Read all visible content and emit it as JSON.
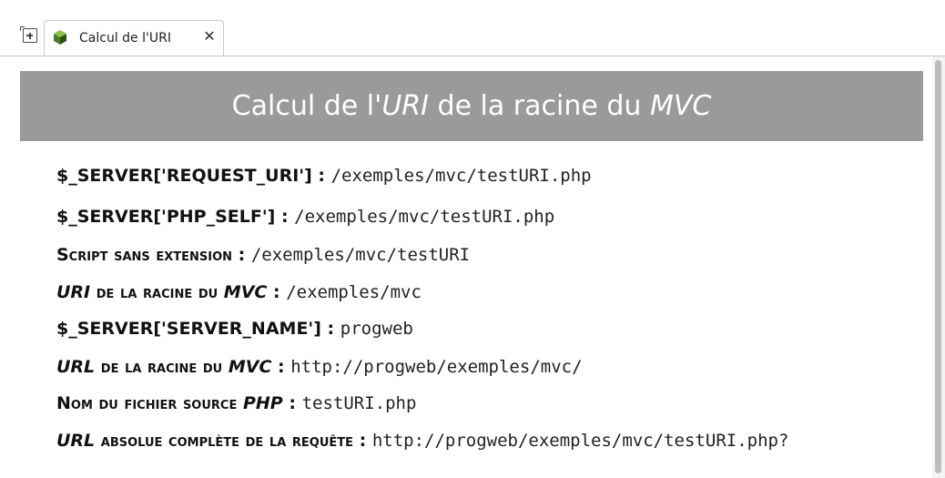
{
  "tab": {
    "new_tab_icon": "pin-tab-icon",
    "site_icon": "cube-icon",
    "title": "Calcul de l'URI",
    "close_glyph": "✕",
    "close_icon": "close-icon"
  },
  "page": {
    "heading_part1": "Calcul de l'",
    "heading_em1": "URI",
    "heading_part2": " de la racine du ",
    "heading_em2": "MVC",
    "heading_bg": "#9a9a9a"
  },
  "rows": [
    {
      "label": "$_SERVER['REQUEST_URI']",
      "sep": " : ",
      "value": "/exemples/mvc/testURI.php"
    },
    {
      "label": "$_SERVER['PHP_SELF']",
      "sep": " : ",
      "value": "/exemples/mvc/testURI.php"
    },
    {
      "label": "Script sans extension",
      "sep": " : ",
      "value": "/exemples/mvc/testURI"
    },
    {
      "label_em1": "URI",
      "label_mid": " de la racine du ",
      "label_em2": "MVC",
      "sep": " : ",
      "value": "/exemples/mvc"
    },
    {
      "label": "$_SERVER['SERVER_NAME']",
      "sep": " : ",
      "value": "progweb"
    },
    {
      "label_em1": "URL",
      "label_mid": " de la racine du ",
      "label_em2": "MVC",
      "sep": " : ",
      "value": "http://progweb/exemples/mvc/"
    },
    {
      "label": "Nom du fichier source ",
      "label_em2": "PHP",
      "sep": " : ",
      "value": "testURI.php"
    },
    {
      "label_em1": "URL",
      "label_mid": " absolue complète de la requête",
      "sep": " : ",
      "value": "http://progweb/exemples/mvc/testURI.php?"
    }
  ]
}
